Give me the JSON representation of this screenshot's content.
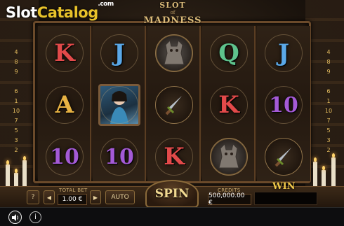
{
  "site_logo": {
    "part1": "Slot",
    "part2": "Catalog",
    "suffix": ".com"
  },
  "game_title": {
    "line1": "SLOT",
    "line2": "of",
    "line3": "MADNESS"
  },
  "paylines_left": [
    "4",
    "8",
    "9",
    "",
    "6",
    "1",
    "10",
    "7",
    "5",
    "3",
    "2"
  ],
  "paylines_right": [
    "4",
    "8",
    "9",
    "",
    "6",
    "1",
    "10",
    "7",
    "5",
    "3",
    "2"
  ],
  "reels": [
    [
      "K",
      "A",
      "10"
    ],
    [
      "J",
      "lady",
      "10"
    ],
    [
      "gargoyle",
      "dagger",
      "K"
    ],
    [
      "Q",
      "K",
      "gargoyle"
    ],
    [
      "J",
      "10",
      "dagger"
    ]
  ],
  "controls": {
    "help_label": "?",
    "prev_arrow": "◀",
    "next_arrow": "▶",
    "total_bet_label": "TOTAL BET",
    "total_bet_value": "1.00 €",
    "auto_label": "AUTO",
    "spin_label": "SPIN",
    "credits_label": "CREDITS",
    "credits_value": "500,000.00 €",
    "win_label": "WIN",
    "win_value": ""
  },
  "footer": {
    "sound_icon": "speaker-icon",
    "info_label": "i"
  },
  "colors": {
    "accent": "#e8c22a",
    "frame": "#6b4a2a"
  }
}
